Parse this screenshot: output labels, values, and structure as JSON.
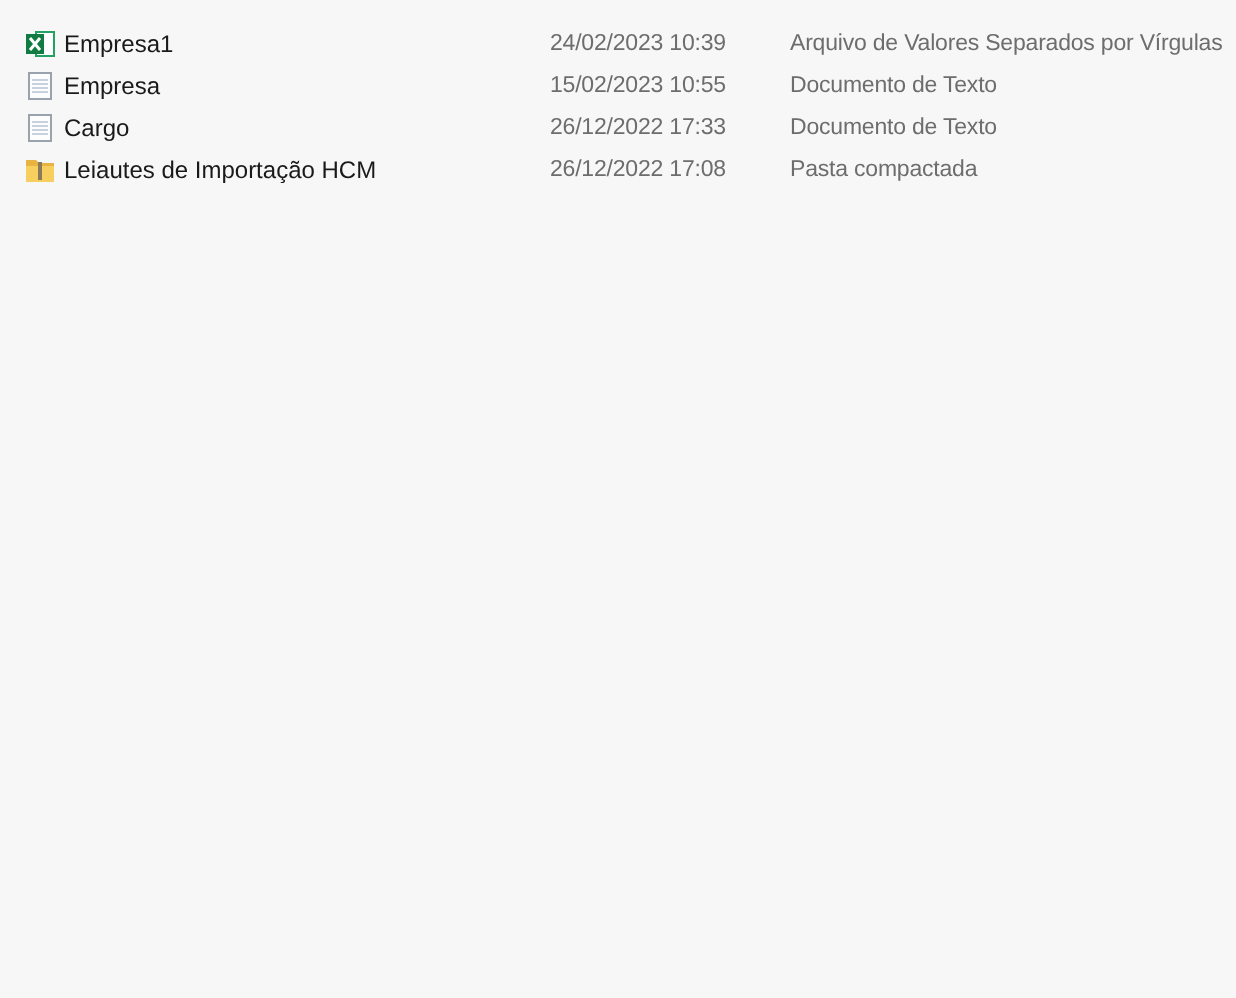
{
  "files": [
    {
      "kind": "csv",
      "name": "Empresa1",
      "modified": "24/02/2023 10:39",
      "type": "Arquivo de Valores Separados por Vírgulas"
    },
    {
      "kind": "text",
      "name": "Empresa",
      "modified": "15/02/2023 10:55",
      "type": "Documento de Texto"
    },
    {
      "kind": "text",
      "name": "Cargo",
      "modified": "26/12/2022 17:33",
      "type": "Documento de Texto"
    },
    {
      "kind": "zip",
      "name": "Leiautes de Importação HCM",
      "modified": "26/12/2022 17:08",
      "type": "Pasta compactada"
    }
  ]
}
